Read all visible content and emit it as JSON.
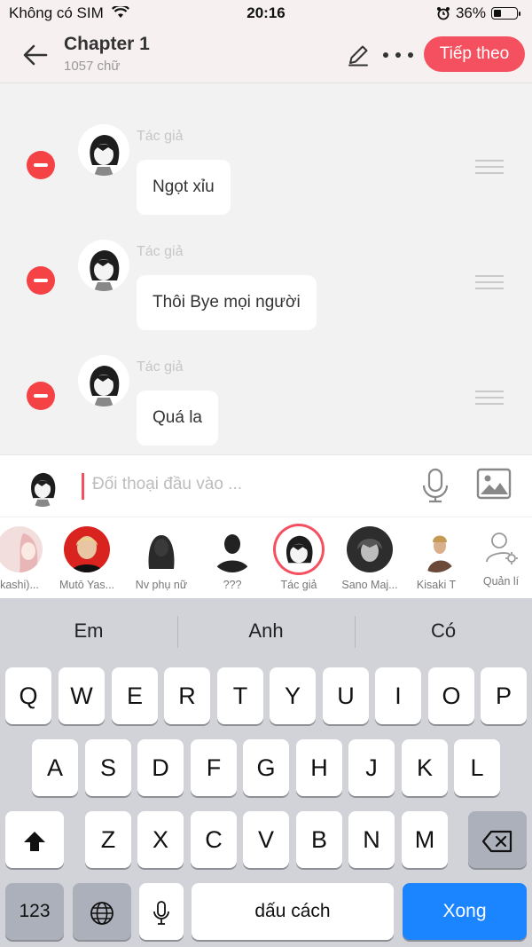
{
  "status_bar": {
    "carrier": "Không có SIM",
    "time": "20:16",
    "battery": "36%",
    "battery_level": 0.36
  },
  "header": {
    "title": "Chapter 1",
    "subtitle": "1057 chữ",
    "next_button": "Tiếp theo"
  },
  "messages": [
    {
      "author": "Tác giả",
      "text": "Ngọt xỉu"
    },
    {
      "author": "Tác giả",
      "text": "Thôi Bye mọi người"
    },
    {
      "author": "Tác giả",
      "text": "Quá la"
    }
  ],
  "input": {
    "placeholder": "Đối thoại đầu vào ..."
  },
  "characters": [
    {
      "name": "kashi)..."
    },
    {
      "name": "Mutō Yas..."
    },
    {
      "name": "Nv phụ nữ"
    },
    {
      "name": "???"
    },
    {
      "name": "Tác giả",
      "selected": true
    },
    {
      "name": "Sano Maj..."
    },
    {
      "name": "Kisaki T"
    }
  ],
  "manage_label": "Quản lí",
  "keyboard": {
    "suggestions": [
      "Em",
      "Anh",
      "Có"
    ],
    "row1": [
      "Q",
      "W",
      "E",
      "R",
      "T",
      "Y",
      "U",
      "I",
      "O",
      "P"
    ],
    "row2": [
      "A",
      "S",
      "D",
      "F",
      "G",
      "H",
      "J",
      "K",
      "L"
    ],
    "row3": [
      "Z",
      "X",
      "C",
      "V",
      "B",
      "N",
      "M"
    ],
    "numbers_key": "123",
    "space_key": "dấu cách",
    "done_key": "Xong"
  },
  "colors": {
    "accent": "#f5505f",
    "delete_red": "#f44245",
    "done_blue": "#1b84ff"
  }
}
